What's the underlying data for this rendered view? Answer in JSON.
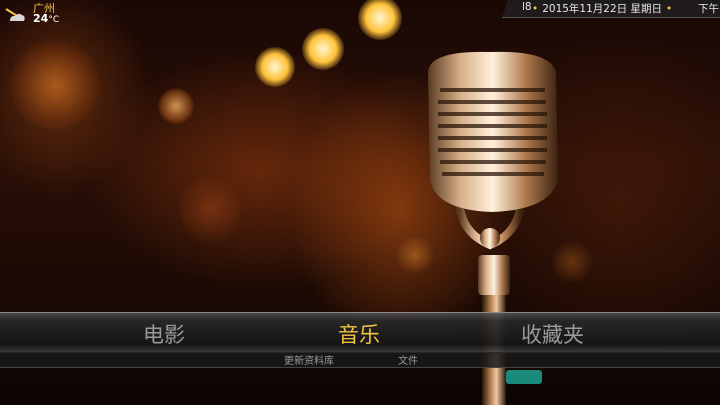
{
  "weather": {
    "city": "广州",
    "temperature": "24",
    "unit": "°C",
    "icon": "partly-cloudy-icon"
  },
  "clock": {
    "prefix": "l8",
    "date": "2015年11月22日 星期日",
    "suffix": "下午"
  },
  "main_menu": {
    "items": [
      "电影",
      "音乐",
      "收藏夹"
    ],
    "active": "音乐"
  },
  "submenu": {
    "items": [
      "更新资料库",
      "文件"
    ]
  },
  "colors": {
    "accent": "#f4c542",
    "inactive": "#9a9a9a"
  }
}
